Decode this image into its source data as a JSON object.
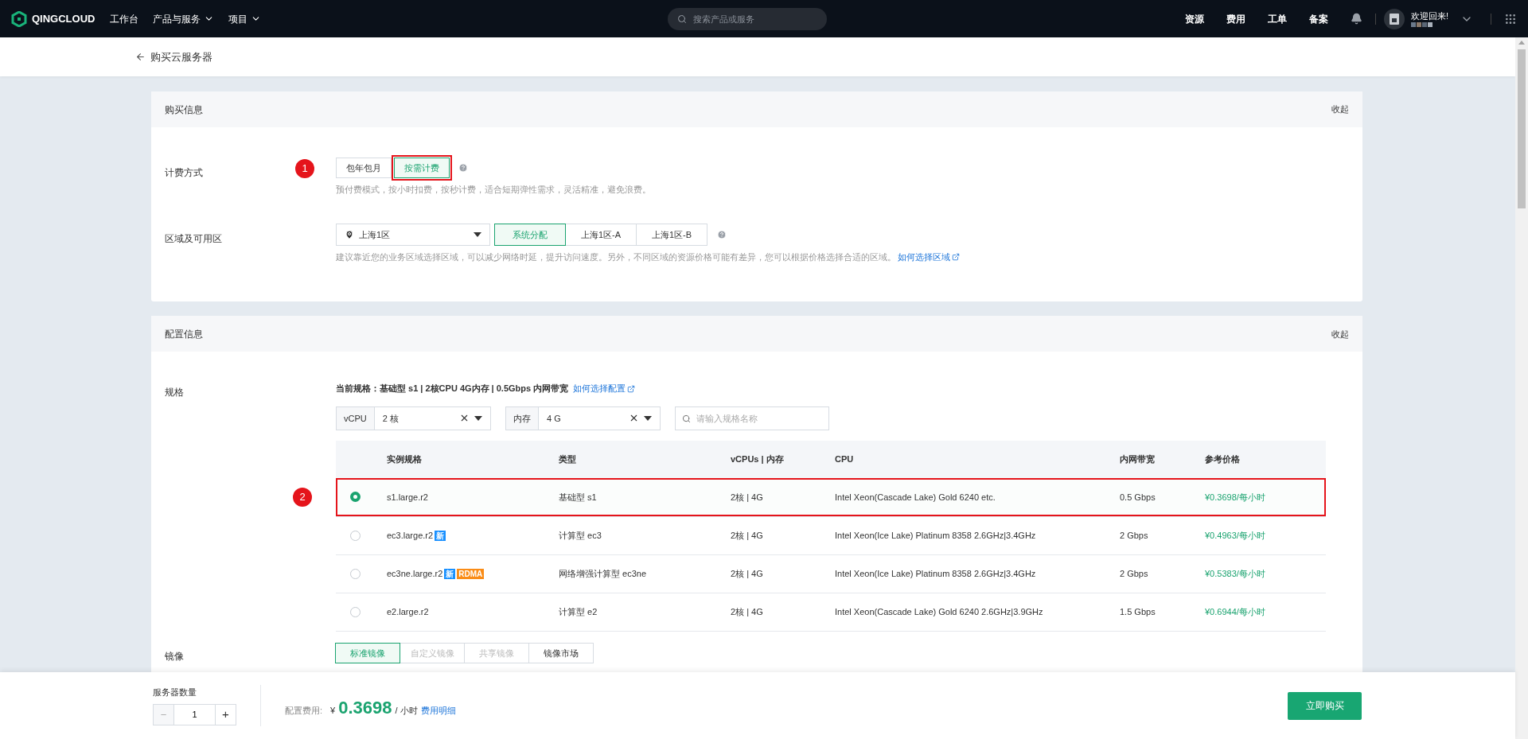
{
  "top_nav": {
    "logo": "QINGCLOUD",
    "menu": [
      {
        "label": "工作台",
        "dropdown": false
      },
      {
        "label": "产品与服务",
        "dropdown": true
      },
      {
        "label": "项目",
        "dropdown": true
      }
    ],
    "search": {
      "placeholder": "搜索产品或服务"
    },
    "links": [
      "资源",
      "费用",
      "工单",
      "备案"
    ],
    "greeting": "欢迎回来!"
  },
  "page_header": {
    "title": "购买云服务器"
  },
  "purchase": {
    "title": "购买信息",
    "collapse": "收起",
    "billing": {
      "label": "计费方式",
      "marker": "1",
      "options": [
        {
          "label": "包年包月",
          "selected": false
        },
        {
          "label": "按需计费",
          "selected": true
        }
      ],
      "hint": "预付费模式，按小时扣费，按秒计费，适合短期弹性需求，灵活精准，避免浪费。"
    },
    "region": {
      "label": "区域及可用区",
      "value": "上海1区",
      "zones": [
        {
          "label": "系统分配",
          "selected": true
        },
        {
          "label": "上海1区-A",
          "selected": false
        },
        {
          "label": "上海1区-B",
          "selected": false
        }
      ],
      "hint": "建议靠近您的业务区域选择区域，可以减少网络时延，提升访问速度。另外，不同区域的资源价格可能有差异，您可以根据价格选择合适的区域。",
      "link": "如何选择区域"
    }
  },
  "config": {
    "title": "配置信息",
    "collapse": "收起",
    "spec": {
      "label": "规格",
      "current_prefix": "当前规格：",
      "current_value": "基础型 s1 | 2核CPU 4G内存 | 0.5Gbps 内网带宽",
      "link": "如何选择配置",
      "filters": [
        {
          "label": "vCPU",
          "value": "2 核"
        },
        {
          "label": "内存",
          "value": "4 G"
        }
      ],
      "search": {
        "placeholder": "请输入规格名称"
      },
      "columns": [
        "实例规格",
        "类型",
        "vCPUs | 内存",
        "CPU",
        "内网带宽",
        "参考价格"
      ],
      "rows": [
        {
          "selected": true,
          "marker": "2",
          "name": "s1.large.r2",
          "badges": [],
          "type": "基础型 s1",
          "cpu_mem": "2核 | 4G",
          "cpu": "Intel Xeon(Cascade Lake) Gold 6240 etc.",
          "bandwidth": "0.5 Gbps",
          "price": "¥0.3698/每小时"
        },
        {
          "selected": false,
          "name": "ec3.large.r2",
          "badges": [
            {
              "text": "新",
              "color": "#1890ff"
            }
          ],
          "type": "计算型 ec3",
          "cpu_mem": "2核 | 4G",
          "cpu": "Intel Xeon(Ice Lake) Platinum 8358 2.6GHz|3.4GHz",
          "bandwidth": "2 Gbps",
          "price": "¥0.4963/每小时"
        },
        {
          "selected": false,
          "name": "ec3ne.large.r2",
          "badges": [
            {
              "text": "新",
              "color": "#1890ff"
            },
            {
              "text": "RDMA",
              "color": "#fa8c16"
            }
          ],
          "type": "网络增强计算型 ec3ne",
          "cpu_mem": "2核 | 4G",
          "cpu": "Intel Xeon(Ice Lake) Platinum 8358 2.6GHz|3.4GHz",
          "bandwidth": "2 Gbps",
          "price": "¥0.5383/每小时"
        },
        {
          "selected": false,
          "name": "e2.large.r2",
          "badges": [],
          "type": "计算型 e2",
          "cpu_mem": "2核 | 4G",
          "cpu": "Intel Xeon(Cascade Lake) Gold 6240 2.6GHz|3.9GHz",
          "bandwidth": "1.5 Gbps",
          "price": "¥0.6944/每小时"
        }
      ]
    },
    "image": {
      "label": "镜像",
      "tabs": [
        {
          "label": "标准镜像",
          "selected": true,
          "disabled": false
        },
        {
          "label": "自定义镜像",
          "selected": false,
          "disabled": true
        },
        {
          "label": "共享镜像",
          "selected": false,
          "disabled": true
        },
        {
          "label": "镜像市场",
          "selected": false,
          "disabled": false
        }
      ]
    }
  },
  "footer": {
    "quantity_label": "服务器数量",
    "quantity": "1",
    "minus": "−",
    "plus": "+",
    "price_label": "配置费用:",
    "currency": "¥",
    "price": "0.3698",
    "unit": "/ 小时",
    "detail_link": "费用明细",
    "buy": "立即购买"
  }
}
